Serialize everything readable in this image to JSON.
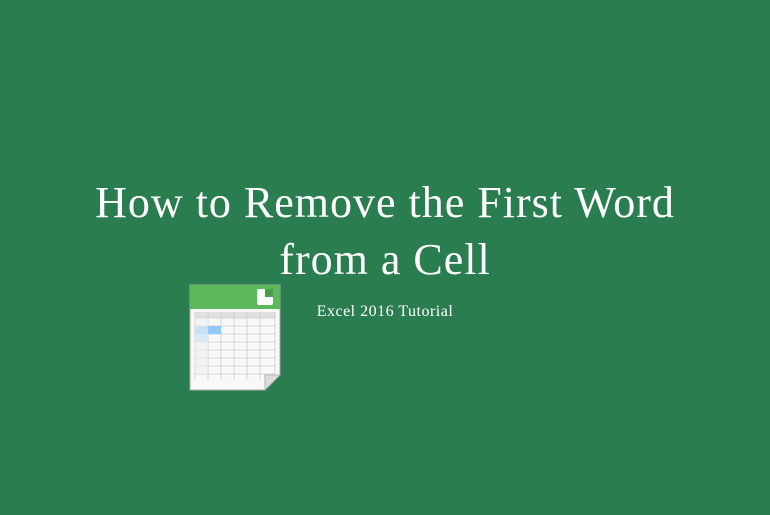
{
  "title": "How to Remove the First Word from a Cell",
  "subtitle": "Excel 2016 Tutorial",
  "icon_name": "spreadsheet-icon",
  "colors": {
    "background": "#2a7d4f",
    "text": "#ffffff",
    "icon_green": "#4caf50",
    "icon_white": "#f5f5f5",
    "icon_gray": "#cccccc"
  }
}
